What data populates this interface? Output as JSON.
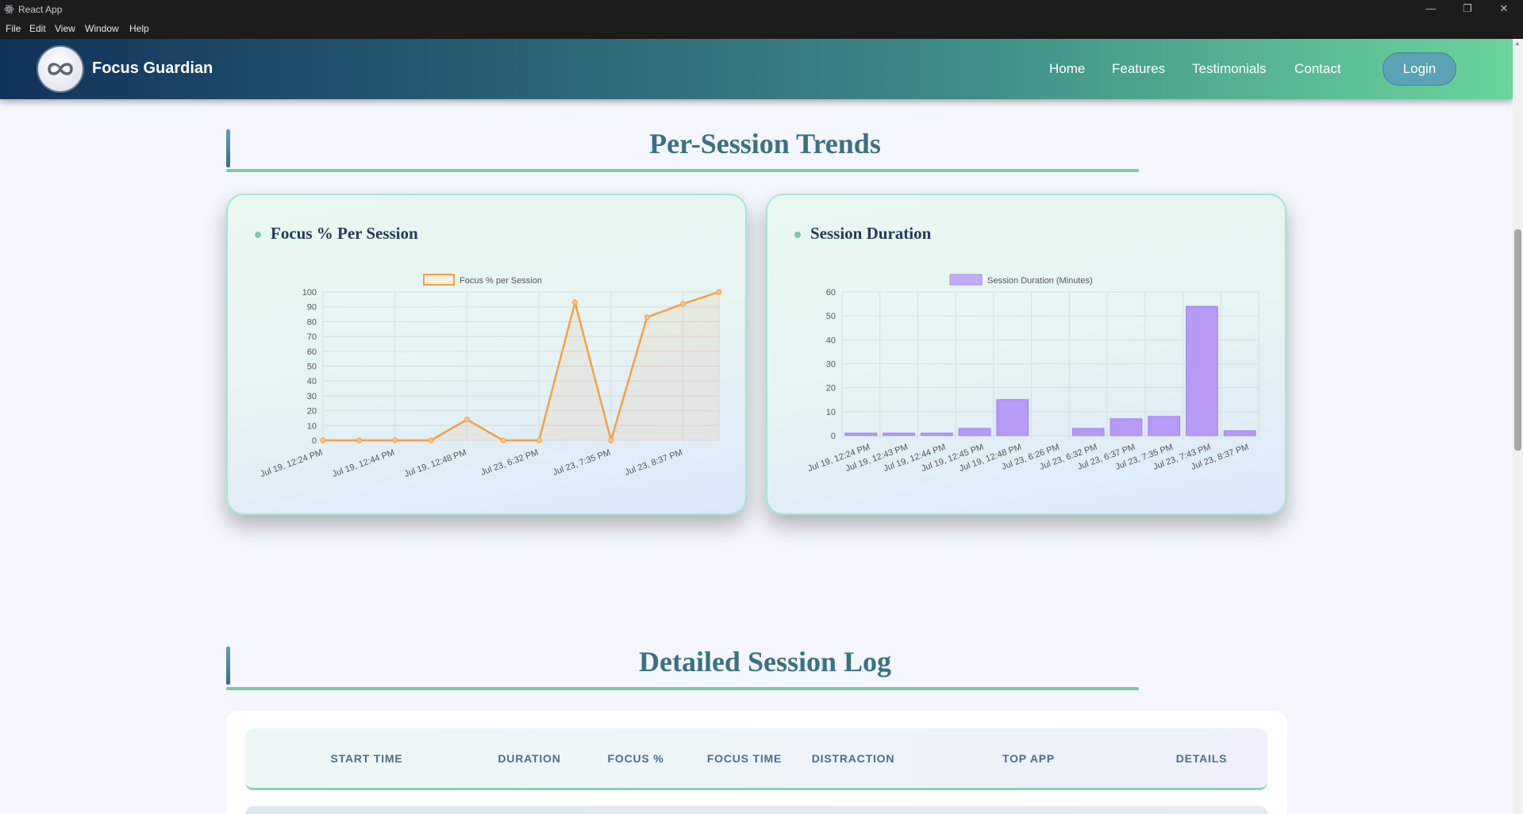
{
  "window": {
    "title": "React App",
    "controls": [
      "minimize",
      "restore",
      "close"
    ]
  },
  "menu": [
    "File",
    "Edit",
    "View",
    "Window",
    "Help"
  ],
  "nav": {
    "brand": "Focus Guardian",
    "links": [
      "Home",
      "Features",
      "Testimonials",
      "Contact"
    ],
    "login": "Login",
    "logo_icon": "infinity-logo-icon"
  },
  "sections": {
    "trends_title": "Per-Session Trends",
    "log_title": "Detailed Session Log"
  },
  "cards": {
    "focus_title": "Focus % Per Session",
    "duration_title": "Session Duration"
  },
  "chart_data": [
    {
      "type": "line",
      "legend": "Focus % per Session",
      "color": "#f59f45",
      "ylim": [
        0,
        100
      ],
      "yticks": [
        0,
        10,
        20,
        30,
        40,
        50,
        60,
        70,
        80,
        90,
        100
      ],
      "x_tick_labels": [
        "Jul 19, 12:24 PM",
        "Jul 19, 12:44 PM",
        "Jul 19, 12:48 PM",
        "Jul 23, 6:32 PM",
        "Jul 23, 7:35 PM",
        "Jul 23, 8:37 PM"
      ],
      "values": [
        0,
        0,
        0,
        0,
        14,
        0,
        0,
        93,
        0,
        83,
        92,
        100
      ],
      "grid": true,
      "fill": true,
      "legend_position": "top"
    },
    {
      "type": "bar",
      "legend": "Session Duration (Minutes)",
      "color": "#b69af5",
      "ylim": [
        0,
        60
      ],
      "yticks": [
        0,
        10,
        20,
        30,
        40,
        50,
        60
      ],
      "categories": [
        "Jul 19, 12:24 PM",
        "Jul 19, 12:43 PM",
        "Jul 19, 12:44 PM",
        "Jul 19, 12:45 PM",
        "Jul 19, 12:48 PM",
        "Jul 23, 6:26 PM",
        "Jul 23, 6:32 PM",
        "Jul 23, 6:37 PM",
        "Jul 23, 7:35 PM",
        "Jul 23, 7:43 PM",
        "Jul 23, 8:37 PM"
      ],
      "values": [
        1,
        1,
        1,
        3,
        15,
        0,
        3,
        7,
        8,
        54,
        2
      ],
      "grid": true,
      "legend_position": "top"
    }
  ],
  "table": {
    "headers": [
      "START TIME",
      "DURATION",
      "FOCUS %",
      "FOCUS TIME",
      "DISTRACTION",
      "TOP APP",
      "DETAILS"
    ]
  }
}
